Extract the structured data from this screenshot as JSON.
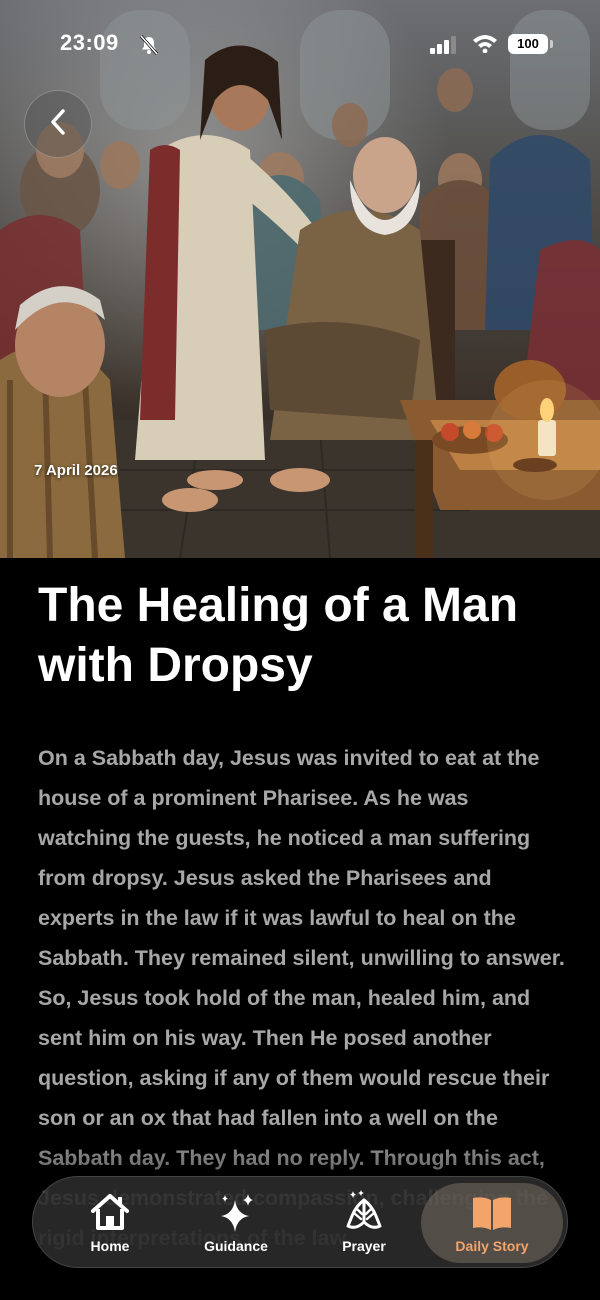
{
  "status_bar": {
    "time": "23:09",
    "battery": "100"
  },
  "hero": {
    "date": "7 April 2026"
  },
  "article": {
    "title": "The Healing of a Man with Dropsy",
    "body": "On a Sabbath day, Jesus was invited to eat at the house of a prominent Pharisee. As he was watching the guests, he noticed a man suffering from dropsy. Jesus asked the Pharisees and experts in the law if it was lawful to heal on the Sabbath. They remained silent, unwilling to answer. So, Jesus took hold of the man, healed him, and sent him on his way. Then He posed another question, asking if any of them would rescue their son or an ox that had fallen into a well on the Sabbath day. They had no reply. Through this act, Jesus demonstrated compassion, challenging the rigid interpretations of the law."
  },
  "tab_bar": {
    "tabs": [
      {
        "label": "Home",
        "icon": "home-icon"
      },
      {
        "label": "Guidance",
        "icon": "sparkles-icon"
      },
      {
        "label": "Prayer",
        "icon": "praying-hands-icon"
      },
      {
        "label": "Daily Story",
        "icon": "open-book-icon",
        "active": true
      }
    ],
    "active_color": "#f2a46b"
  }
}
